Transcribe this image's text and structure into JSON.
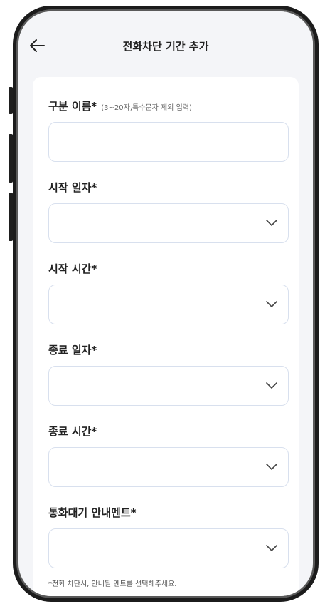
{
  "header": {
    "title": "전화차단 기간 추가",
    "back_icon": "arrow-left-icon"
  },
  "form": {
    "name": {
      "label": "구분 이름*",
      "hint": "(3~20자,특수문자 제외 입력)",
      "value": ""
    },
    "start_date": {
      "label": "시작 일자*",
      "value": ""
    },
    "start_time": {
      "label": "시작 시간*",
      "value": ""
    },
    "end_date": {
      "label": "종료 일자*",
      "value": ""
    },
    "end_time": {
      "label": "종료 시간*",
      "value": ""
    },
    "hold_message": {
      "label": "통화대기 안내멘트*",
      "value": ""
    },
    "note": "*전화 차단시, 안내될 멘트를 선택해주세요."
  },
  "colors": {
    "screen_bg": "#f4f5f8",
    "card_bg": "#ffffff",
    "field_border": "#d8e0ee",
    "frame": "#1c1c1c"
  }
}
